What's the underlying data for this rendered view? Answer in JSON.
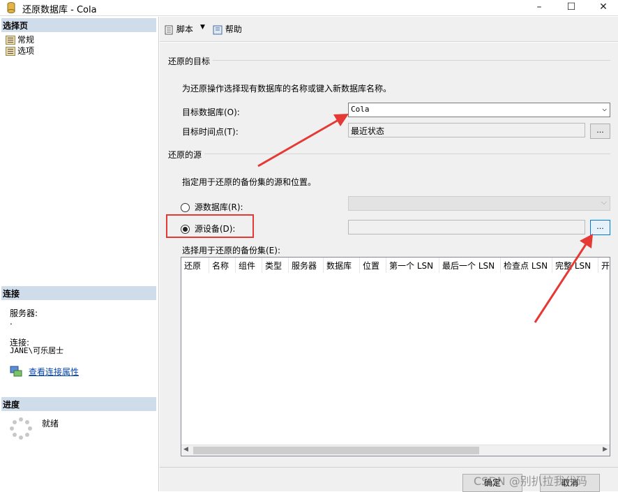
{
  "window": {
    "title": "还原数据库 - Cola",
    "controls": [
      "–",
      "☐",
      "✕"
    ]
  },
  "left": {
    "select_page_header": "选择页",
    "pages": [
      "常规",
      "选项"
    ],
    "connection_header": "连接",
    "server_label": "服务器:",
    "server_value": ".",
    "connection_label": "连接:",
    "connection_value": "JANE\\可乐居士",
    "view_props_link": "查看连接属性",
    "progress_header": "进度",
    "progress_status": "就绪"
  },
  "toolbar": {
    "script_label": "脚本",
    "help_label": "帮助"
  },
  "restore": {
    "target_group": "还原的目标",
    "target_desc": "为还原操作选择现有数据库的名称或键入新数据库名称。",
    "target_db_label": "目标数据库(O):",
    "target_db_value": "Cola",
    "target_time_label": "目标时间点(T):",
    "target_time_value": "最近状态",
    "source_group": "还原的源",
    "source_desc": "指定用于还原的备份集的源和位置。",
    "source_db_label": "源数据库(R):",
    "source_device_label": "源设备(D):",
    "backup_sets_label": "选择用于还原的备份集(E):",
    "columns": [
      "还原",
      "名称",
      "组件",
      "类型",
      "服务器",
      "数据库",
      "位置",
      "第一个 LSN",
      "最后一个 LSN",
      "检查点 LSN",
      "完整 LSN",
      "开"
    ],
    "browse_label": "..."
  },
  "footer": {
    "ok_label": "确定",
    "cancel_label": "取消",
    "watermark": "CSDN @别扒拉我代码"
  },
  "colors": {
    "section_header": "#cfdcea",
    "annotation_red": "#e53935",
    "panel_bg": "#f0f0f0"
  }
}
